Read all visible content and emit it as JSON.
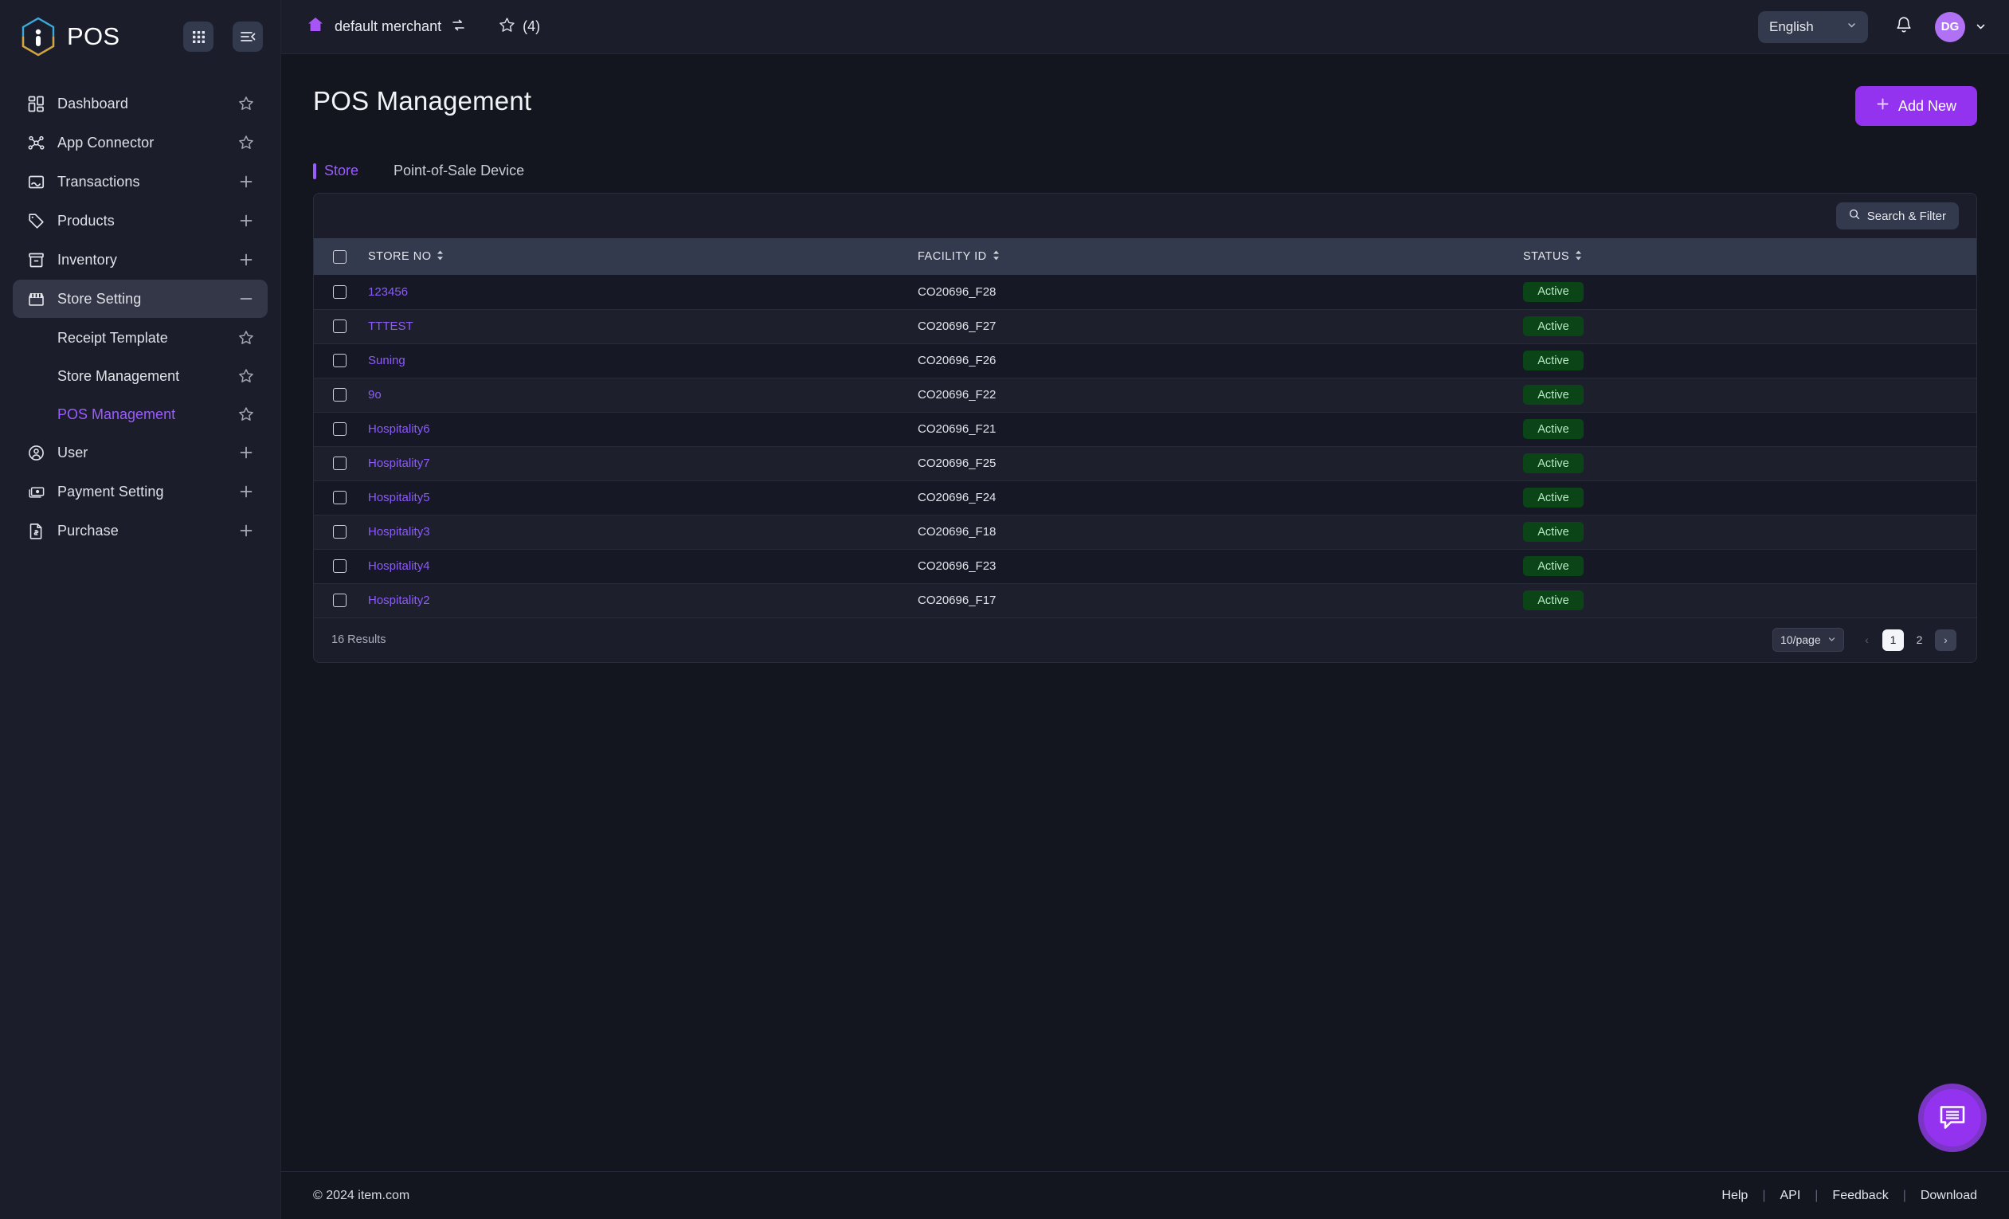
{
  "sidebar": {
    "brand": "POS",
    "grid_button": "grid-view",
    "collapse_button": "collapse-sidebar",
    "items": [
      {
        "label": "Dashboard",
        "icon": "dashboard-icon",
        "action": "star"
      },
      {
        "label": "App Connector",
        "icon": "connector-icon",
        "action": "star"
      },
      {
        "label": "Transactions",
        "icon": "transactions-icon",
        "action": "plus"
      },
      {
        "label": "Products",
        "icon": "tag-icon",
        "action": "plus"
      },
      {
        "label": "Inventory",
        "icon": "inventory-icon",
        "action": "plus"
      },
      {
        "label": "Store Setting",
        "icon": "store-icon",
        "action": "minus",
        "active": true
      },
      {
        "label": "User",
        "icon": "user-icon",
        "action": "plus"
      },
      {
        "label": "Payment Setting",
        "icon": "payment-icon",
        "action": "plus"
      },
      {
        "label": "Purchase",
        "icon": "purchase-icon",
        "action": "plus"
      }
    ],
    "sub_items": [
      {
        "label": "Receipt Template",
        "action": "star"
      },
      {
        "label": "Store Management",
        "action": "star"
      },
      {
        "label": "POS Management",
        "action": "star",
        "current": true
      }
    ]
  },
  "topbar": {
    "home_icon": "home-icon",
    "merchant": "default merchant",
    "switch_icon": "switch-icon",
    "favorites_icon": "star-icon",
    "favorites_count": "(4)",
    "language": "English",
    "notification_icon": "bell-icon",
    "avatar_initials": "DG"
  },
  "page": {
    "title": "POS Management",
    "add_new_label": "Add New",
    "tabs": [
      {
        "label": "Store",
        "active": true
      },
      {
        "label": "Point-of-Sale Device",
        "active": false
      }
    ],
    "search_filter_label": "Search & Filter"
  },
  "table": {
    "columns": [
      {
        "key": "checkbox",
        "label": ""
      },
      {
        "key": "store_no",
        "label": "STORE NO",
        "sortable": true
      },
      {
        "key": "facility_id",
        "label": "FACILITY ID",
        "sortable": true
      },
      {
        "key": "status",
        "label": "STATUS",
        "sortable": true
      }
    ],
    "rows": [
      {
        "store_no": "123456",
        "facility_id": "CO20696_F28",
        "status": "Active"
      },
      {
        "store_no": "TTTEST",
        "facility_id": "CO20696_F27",
        "status": "Active"
      },
      {
        "store_no": "Suning",
        "facility_id": "CO20696_F26",
        "status": "Active"
      },
      {
        "store_no": "9o",
        "facility_id": "CO20696_F22",
        "status": "Active"
      },
      {
        "store_no": "Hospitality6",
        "facility_id": "CO20696_F21",
        "status": "Active"
      },
      {
        "store_no": "Hospitality7",
        "facility_id": "CO20696_F25",
        "status": "Active"
      },
      {
        "store_no": "Hospitality5",
        "facility_id": "CO20696_F24",
        "status": "Active"
      },
      {
        "store_no": "Hospitality3",
        "facility_id": "CO20696_F18",
        "status": "Active"
      },
      {
        "store_no": "Hospitality4",
        "facility_id": "CO20696_F23",
        "status": "Active"
      },
      {
        "store_no": "Hospitality2",
        "facility_id": "CO20696_F17",
        "status": "Active"
      }
    ]
  },
  "pagination": {
    "results_text": "16 Results",
    "per_page": "10/page",
    "prev_label": "‹",
    "next_label": "›",
    "pages": [
      {
        "label": "1",
        "selected": true
      },
      {
        "label": "2",
        "selected": false
      }
    ]
  },
  "footer": {
    "copyright": "© 2024 item.com",
    "links": [
      "Help",
      "API",
      "Feedback",
      "Download"
    ],
    "separator": "|"
  },
  "chat": {
    "icon": "chat-icon"
  },
  "colors": {
    "accent": "#9333f0",
    "link": "#8b5cf6",
    "status_bg": "#0a4417",
    "status_text": "#b9e9c4",
    "sidebar_bg": "#1b1d2a",
    "page_bg": "#13151f"
  }
}
